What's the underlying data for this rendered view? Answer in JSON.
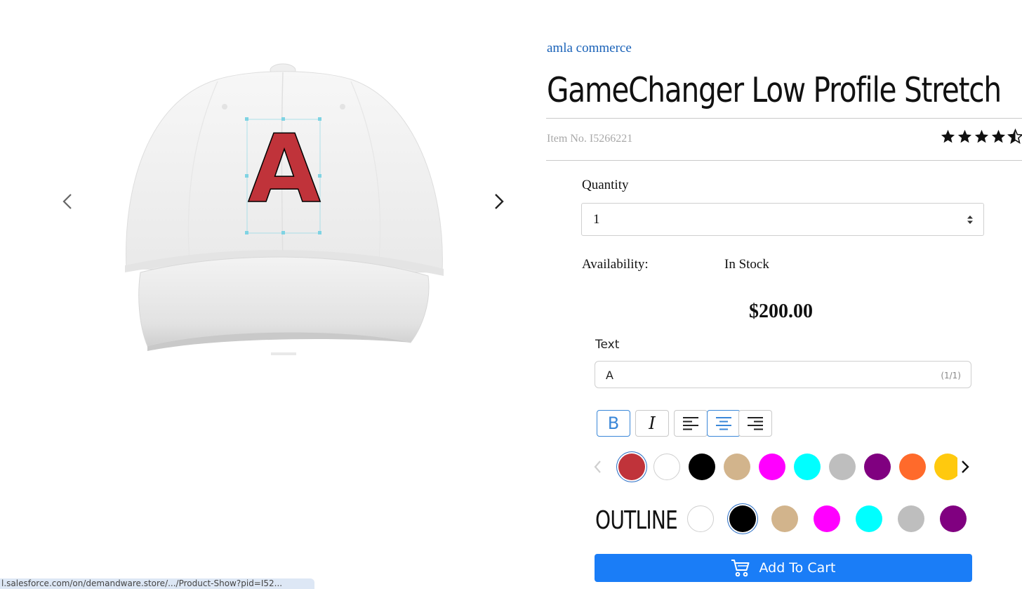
{
  "product": {
    "brand": "amla commerce",
    "title": "GameChanger Low Profile Stretch",
    "item_no": "Item No. I5266221",
    "rating": 4.5,
    "quantity_label": "Quantity",
    "quantity_value": "1",
    "availability_label": "Availability:",
    "availability_value": "In Stock",
    "price": "$200.00"
  },
  "preview": {
    "letter": "A",
    "letter_color": "#C0333A",
    "outline_color": "#000000"
  },
  "customizer": {
    "text_label": "Text",
    "text_value": "A",
    "text_counter": "(1/1)",
    "format_buttons": [
      {
        "name": "bold",
        "glyph": "B",
        "active": true
      },
      {
        "name": "italic",
        "glyph": "I",
        "active": false
      }
    ],
    "align_buttons": [
      {
        "name": "left",
        "active": false
      },
      {
        "name": "center",
        "active": true
      },
      {
        "name": "right",
        "active": false
      }
    ],
    "text_colors": [
      "#C0333A",
      "#FFFFFF",
      "#000000",
      "#D2B48C",
      "#FF00FF",
      "#00FFFF",
      "#BEBEBE",
      "#800080",
      "#FF6A2B",
      "#FFC90E"
    ],
    "text_color_selected": 0,
    "outline_label": "OUTLINE",
    "outline_colors": [
      "#FFFFFF",
      "#000000",
      "#D2B48C",
      "#FF00FF",
      "#00FFFF",
      "#BEBEBE",
      "#800080"
    ],
    "outline_color_selected": 1,
    "add_to_cart_label": "Add To Cart"
  },
  "status_bar": {
    "url": "l.salesforce.com/on/demandware.store/.../Product-Show?pid=I52..."
  },
  "icons": {
    "prev": "chevron-left-icon",
    "next": "chevron-right-icon",
    "cart": "cart-icon",
    "star": "star-icon",
    "caret": "select-caret-icon"
  }
}
